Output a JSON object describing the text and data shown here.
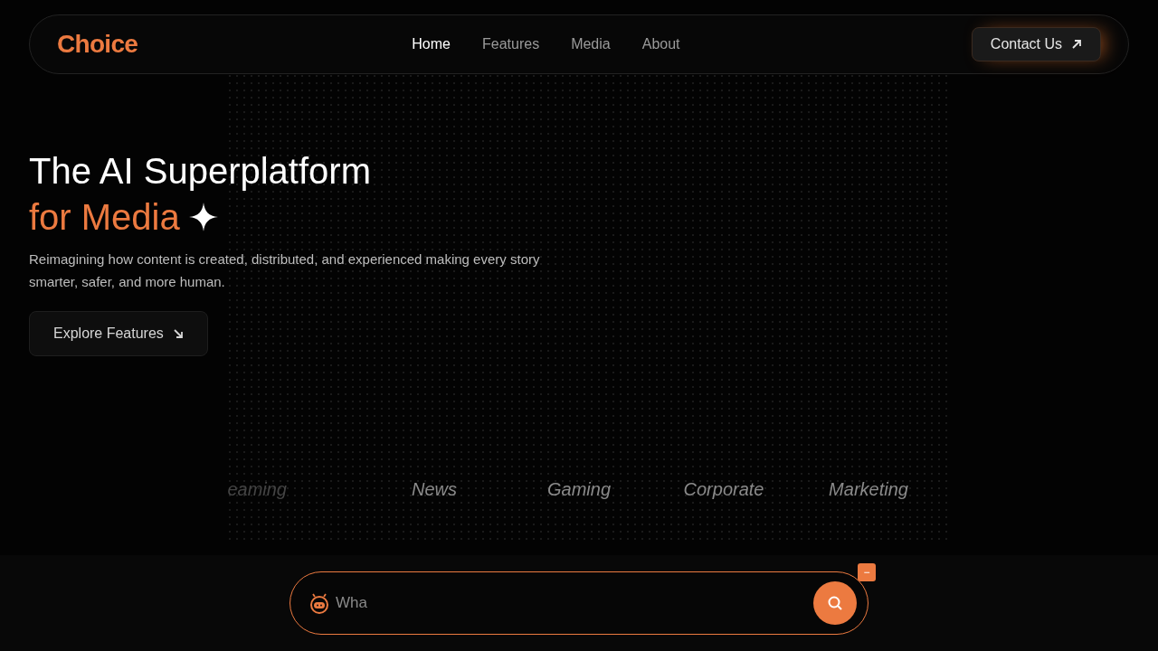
{
  "logo": "Choice",
  "nav": [
    {
      "label": "Home",
      "selected": true
    },
    {
      "label": "Features",
      "selected": false
    },
    {
      "label": "Media",
      "selected": false
    },
    {
      "label": "About",
      "selected": false
    }
  ],
  "contact_button": "Contact Us",
  "hero": {
    "title": "The AI Superplatform",
    "title_accent": "for Media",
    "subtitle": "Reimagining how content is created, distributed, and experienced making every story smarter, safer, and more human.",
    "button": "Explore Features"
  },
  "categories": [
    "eaming",
    "News",
    "Gaming",
    "Corporate",
    "Marketing"
  ],
  "search": {
    "placeholder": "Wha",
    "minimize": "−"
  }
}
